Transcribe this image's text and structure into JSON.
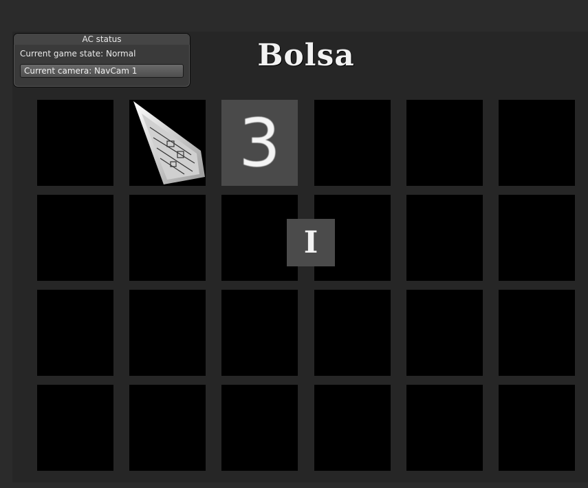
{
  "title": "Bolsa",
  "status_panel": {
    "header": "AC status",
    "game_state": "Current game state: Normal",
    "camera_button": "Current camera: NavCam 1"
  },
  "grid": {
    "rows": 4,
    "cols": 6,
    "revealed_digit": "3",
    "revealed_digit_cell": {
      "row": 1,
      "col": 3
    },
    "card_cell": {
      "row": 1,
      "col": 2
    }
  },
  "cursor_tile_label": "I",
  "colors": {
    "background": "#2b2b2b",
    "cell": "#000000",
    "revealed_cell": "#4a4a4a"
  }
}
